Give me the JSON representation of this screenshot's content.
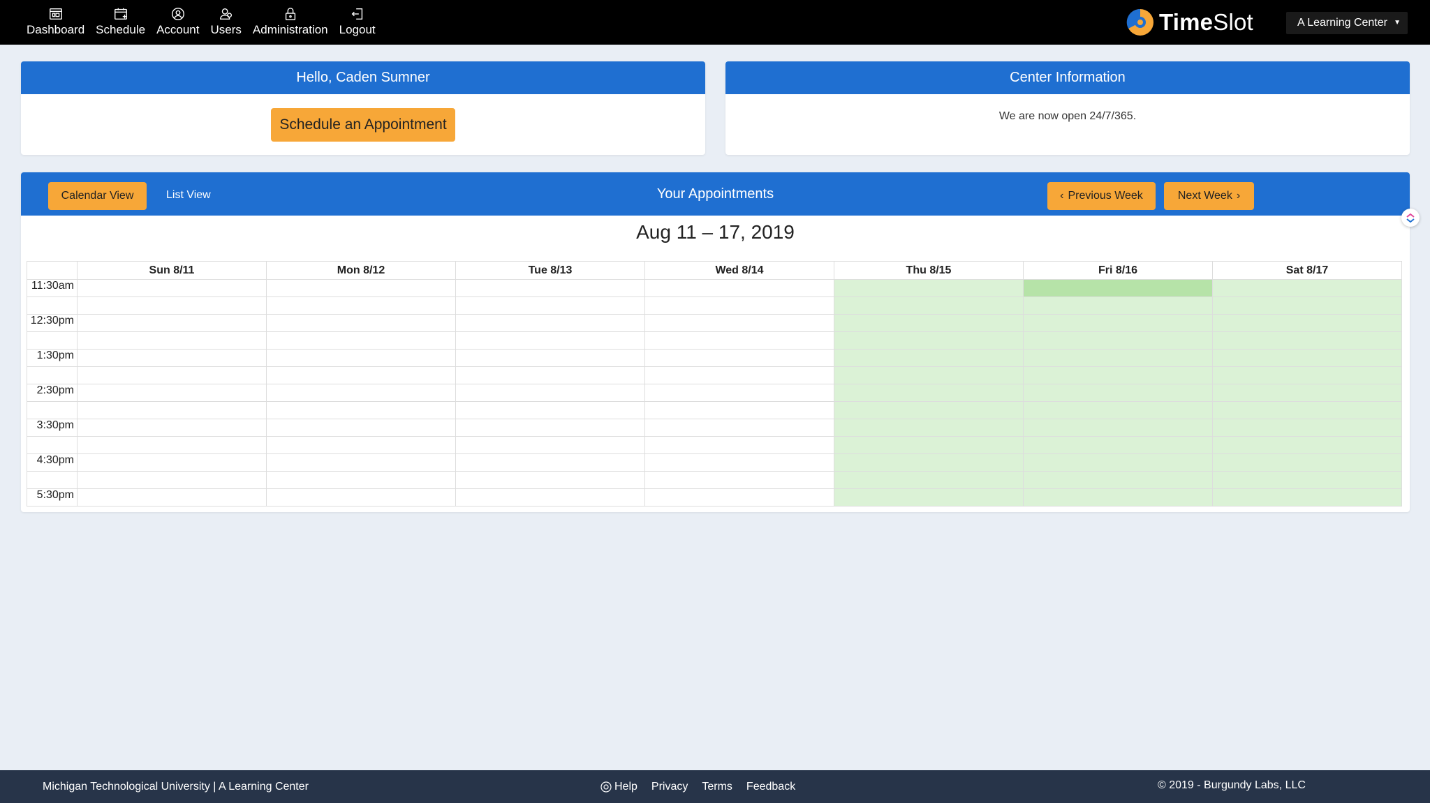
{
  "nav": {
    "items": [
      {
        "label": "Dashboard",
        "icon": "dashboard-icon"
      },
      {
        "label": "Schedule",
        "icon": "calendar-icon"
      },
      {
        "label": "Account",
        "icon": "user-circle-icon"
      },
      {
        "label": "Users",
        "icon": "users-icon"
      },
      {
        "label": "Administration",
        "icon": "lock-icon"
      },
      {
        "label": "Logout",
        "icon": "logout-icon"
      }
    ]
  },
  "brand": {
    "name_bold": "Time",
    "name_light": "Slot",
    "logo": "timeslot-logo"
  },
  "center_select": {
    "selected": "A Learning Center"
  },
  "greeting": {
    "title": "Hello, Caden Sumner",
    "schedule_button": "Schedule an Appointment"
  },
  "center_info": {
    "title": "Center Information",
    "text": "We are now open 24/7/365."
  },
  "appointments": {
    "title": "Your Appointments",
    "calendar_view_label": "Calendar View",
    "list_view_label": "List View",
    "prev_week_label": "Previous Week",
    "next_week_label": "Next Week",
    "week_range": "Aug 11 – 17, 2019",
    "days": [
      "Sun 8/11",
      "Mon 8/12",
      "Tue 8/13",
      "Wed 8/14",
      "Thu 8/15",
      "Fri 8/16",
      "Sat 8/17"
    ],
    "times": [
      "11:30am",
      "12:30pm",
      "1:30pm",
      "2:30pm",
      "3:30pm",
      "4:30pm",
      "5:30pm"
    ],
    "available_days": [
      "Thu 8/15",
      "Fri 8/16",
      "Sat 8/17"
    ],
    "booked_slot": {
      "day": "Fri 8/16",
      "time": "11:30am"
    },
    "colors": {
      "available": "#dbf2d6",
      "booked": "#b6e3a8",
      "header": "#1f6fd1",
      "button": "#f7a738"
    }
  },
  "footer": {
    "left": "Michigan Technological University | A Learning Center",
    "links": {
      "help": "Help",
      "privacy": "Privacy",
      "terms": "Terms",
      "feedback": "Feedback"
    },
    "copyright": "© 2019 - Burgundy Labs, LLC"
  }
}
